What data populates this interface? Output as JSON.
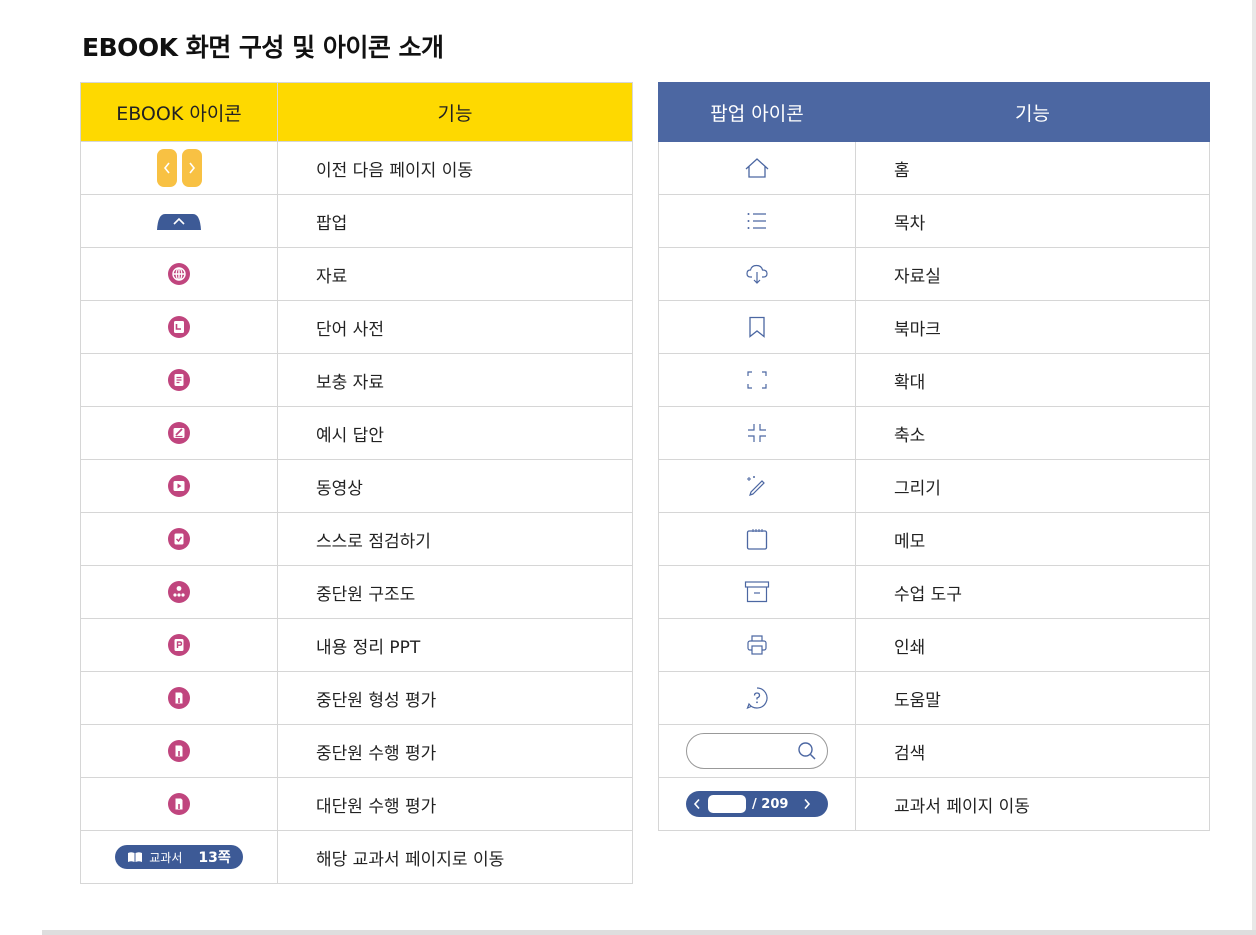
{
  "title": "EBOOK 화면 구성 및 아이콘 소개",
  "left_table": {
    "headers": [
      "EBOOK 아이콘",
      "기능"
    ],
    "rows": [
      {
        "icon": "prev-next-arrows-icon",
        "label": "이전 다음 페이지 이동"
      },
      {
        "icon": "popup-tab-icon",
        "label": "팝업"
      },
      {
        "icon": "globe-icon",
        "label": "자료"
      },
      {
        "icon": "dictionary-icon",
        "label": "단어 사전"
      },
      {
        "icon": "supplement-doc-icon",
        "label": "보충 자료"
      },
      {
        "icon": "sample-answer-icon",
        "label": "예시 답안"
      },
      {
        "icon": "video-icon",
        "label": "동영상"
      },
      {
        "icon": "checklist-icon",
        "label": "스스로 점검하기"
      },
      {
        "icon": "structure-icon",
        "label": "중단원 구조도"
      },
      {
        "icon": "ppt-icon",
        "label": "내용 정리 PPT"
      },
      {
        "icon": "assessment-icon",
        "label": "중단원 형성 평가"
      },
      {
        "icon": "assessment-icon",
        "label": "중단원 수행 평가"
      },
      {
        "icon": "assessment-icon",
        "label": "대단원 수행 평가"
      },
      {
        "icon": "textbook-page-badge",
        "label": "해당 교과서 페이지로 이동",
        "badge_text": "교과서",
        "badge_page": "13쪽"
      }
    ]
  },
  "right_table": {
    "headers": [
      "팝업 아이콘",
      "기능"
    ],
    "rows": [
      {
        "icon": "home-icon",
        "label": "홈"
      },
      {
        "icon": "list-icon",
        "label": "목차"
      },
      {
        "icon": "cloud-download-icon",
        "label": "자료실"
      },
      {
        "icon": "bookmark-icon",
        "label": "북마크"
      },
      {
        "icon": "expand-icon",
        "label": "확대"
      },
      {
        "icon": "shrink-icon",
        "label": "축소"
      },
      {
        "icon": "pencil-icon",
        "label": "그리기"
      },
      {
        "icon": "memo-icon",
        "label": "메모"
      },
      {
        "icon": "toolbox-icon",
        "label": "수업 도구"
      },
      {
        "icon": "printer-icon",
        "label": "인쇄"
      },
      {
        "icon": "help-icon",
        "label": "도움말"
      },
      {
        "icon": "search-icon",
        "label": "검색"
      },
      {
        "icon": "page-nav-icon",
        "label": "교과서 페이지 이동",
        "total_pages": "/ 209"
      }
    ]
  },
  "colors": {
    "left_header": "#fed900",
    "right_header": "#4c67a2",
    "icon_magenta": "#c0457e",
    "icon_blue": "#3d5a96",
    "arrow_yellow": "#f8c143"
  }
}
